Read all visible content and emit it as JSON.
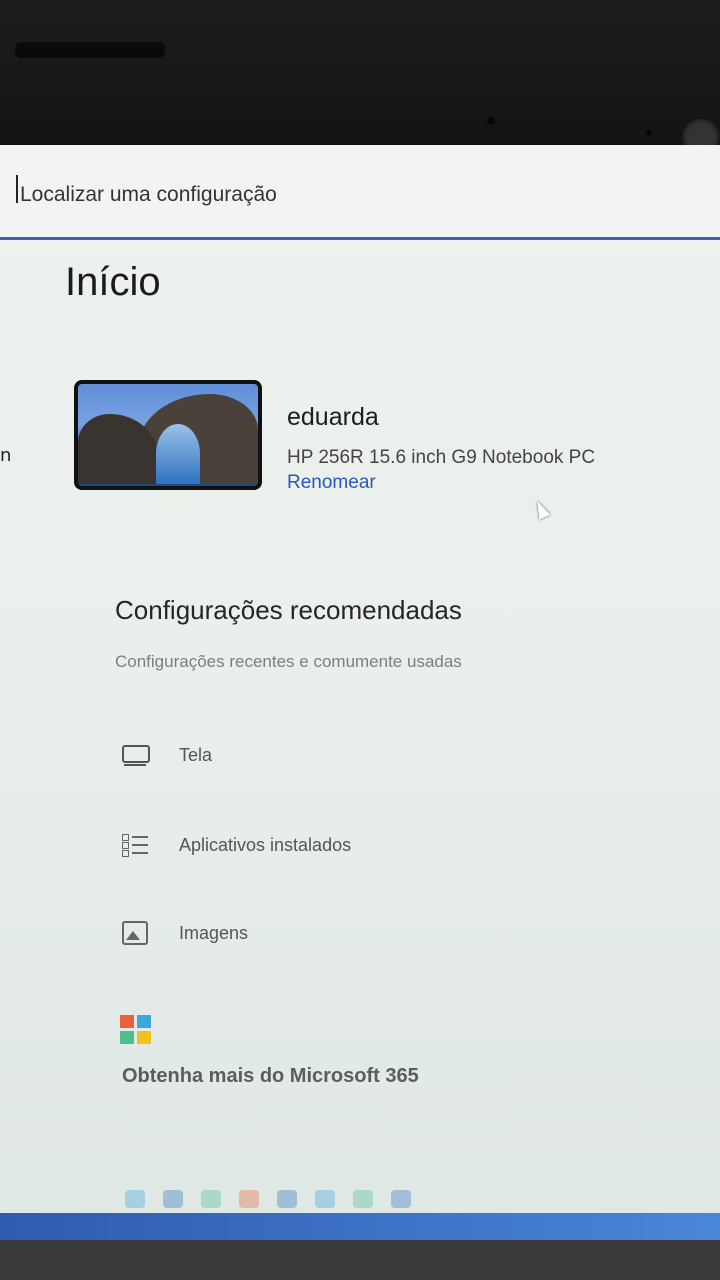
{
  "search": {
    "text": "Localizar uma configuração"
  },
  "sidebar_fragment": "n",
  "page_title": "Início",
  "device": {
    "name": "eduarda",
    "model": "HP 256R 15.6 inch G9 Notebook PC",
    "rename_label": "Renomear"
  },
  "recommended": {
    "title": "Configurações recomendadas",
    "subtitle": "Configurações recentes e comumente usadas",
    "items": [
      {
        "label": "Tela",
        "icon": "display-icon"
      },
      {
        "label": "Aplicativos instalados",
        "icon": "apps-list-icon"
      },
      {
        "label": "Imagens",
        "icon": "image-icon"
      }
    ]
  },
  "microsoft365": {
    "title": "Obtenha mais do Microsoft 365",
    "logo_colors": [
      "#e8623a",
      "#3aa7dd",
      "#4cc08a",
      "#f2c21c"
    ]
  },
  "colors": {
    "accent": "#3d63b0",
    "link": "#2a58b8"
  }
}
